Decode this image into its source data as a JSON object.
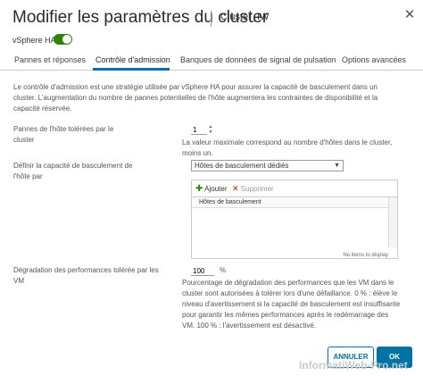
{
  "dialog": {
    "title": "Modifier les paramètres du cluster",
    "cluster_name": "Cluster_IW",
    "close_glyph": "✕"
  },
  "ha": {
    "label": "vSphere HA",
    "enabled": true
  },
  "tabs": [
    {
      "label": "Pannes et réponses",
      "active": false
    },
    {
      "label": "Contrôle d'admission",
      "active": true
    },
    {
      "label": "Banques de données de signal de pulsation",
      "active": false
    },
    {
      "label": "Options avancées",
      "active": false
    }
  ],
  "description": "Le contrôle d'admission est une stratégie utilisée par vSphere HA pour assurer la capacité de basculement dans un cluster. L'augmentation du nombre de pannes potentielles de l'hôte augmentera les contraintes de disponibilité et la capacité réservée.",
  "failures": {
    "label": "Pannes de l'hôte tolérées par le cluster",
    "value": "1",
    "help": "La valeur maximale correspond au nombre d'hôtes dans le cluster, moins un."
  },
  "capacity": {
    "label": "Définir la capacité de basculement de l'hôte par",
    "selected": "Hôtes de basculement dédiés"
  },
  "failover_hosts": {
    "add_label": "Ajouter",
    "remove_label": "Supprimer",
    "column_header": "Hôtes de basculement",
    "footer": "No items to display"
  },
  "performance": {
    "label": "Dégradation des performances tolérée par les VM",
    "value": "100",
    "unit": "%",
    "help": "Pourcentage de dégradation des performances que les VM dans le cluster sont autorisées à tolérer lors d'une défaillance. 0 % : élève le niveau d'avertissement si la capacité de basculement est insuffisante pour garantir les mêmes performances après le redémarrage des VM. 100 % : l'avertissement est désactivé."
  },
  "buttons": {
    "cancel": "ANNULER",
    "ok": "OK"
  },
  "watermark": "InformatiWeb-Pro.net",
  "colors": {
    "accent": "#0072a3",
    "toggle_on": "#2f8400",
    "add_green": "#2f8400",
    "remove_red": "#c92100"
  }
}
